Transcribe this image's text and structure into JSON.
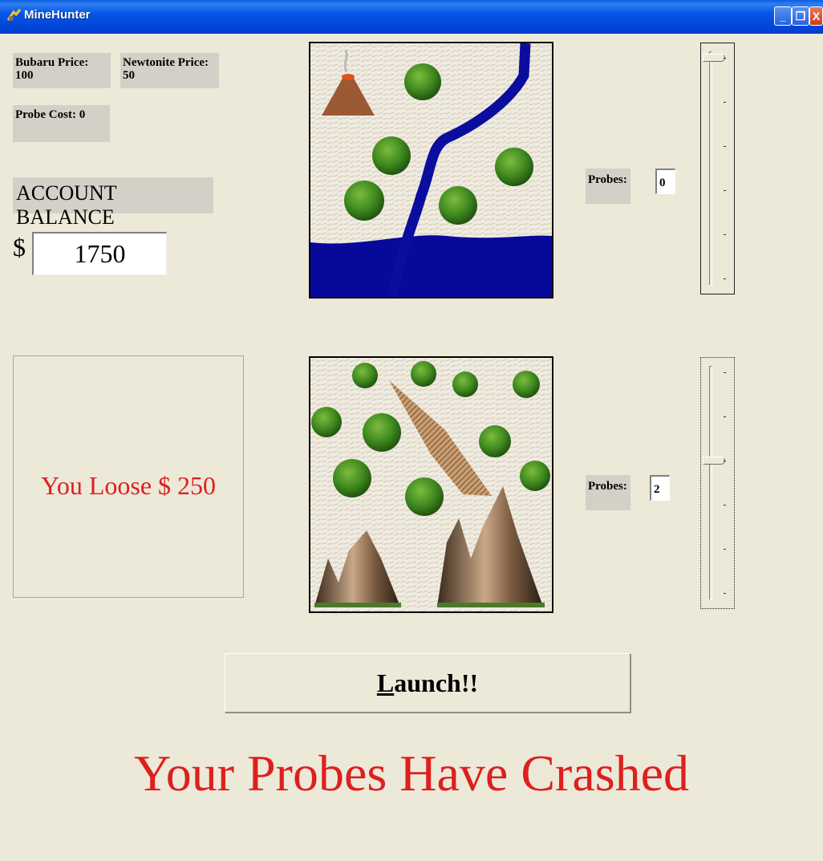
{
  "window": {
    "title": "MineHunter"
  },
  "prices": {
    "bubaru": "Bubaru Price: 100",
    "newtonite_line1": "Newtonite Price:",
    "newtonite_line2": "50",
    "probe_cost": "Probe Cost: 0"
  },
  "account": {
    "label": "ACCOUNT BALANCE",
    "currency": "$",
    "balance": "1750"
  },
  "result": {
    "text": "You Loose $ 250"
  },
  "site1": {
    "probes_label": "Probes:",
    "probes": "0",
    "slider_level": 0
  },
  "site2": {
    "probes_label": "Probes:",
    "probes": "2",
    "slider_level": 2
  },
  "launch": {
    "first_letter": "L",
    "rest": "aunch!!"
  },
  "status": {
    "message": "Your Probes Have Crashed"
  }
}
